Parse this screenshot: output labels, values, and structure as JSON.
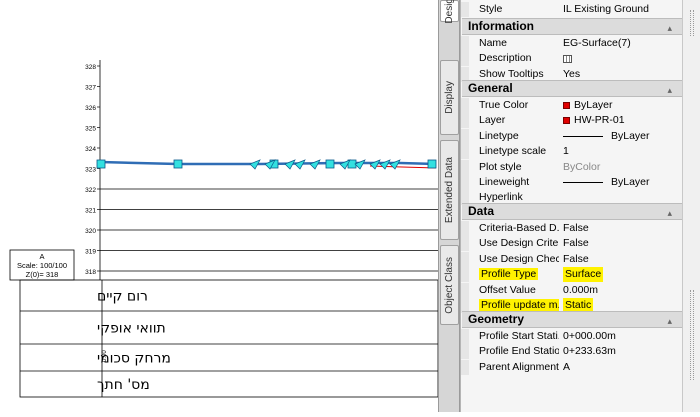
{
  "tabs": [
    {
      "label": "Desig",
      "active": true
    },
    {
      "label": "Display",
      "active": false
    },
    {
      "label": "Extended Data",
      "active": false
    },
    {
      "label": "Object Class",
      "active": false
    }
  ],
  "properties": {
    "top_row": {
      "name": "Style",
      "value": "IL Existing Ground"
    },
    "sections": [
      {
        "title": "Information",
        "rows": [
          {
            "name": "Name",
            "value": "EG-Surface(7)"
          },
          {
            "name": "Description",
            "value": "",
            "icon": "calculator-icon"
          },
          {
            "name": "Show Tooltips",
            "value": "Yes"
          }
        ]
      },
      {
        "title": "General",
        "rows": [
          {
            "name": "True Color",
            "value": "ByLayer",
            "swatch": "#e00000"
          },
          {
            "name": "Layer",
            "value": "HW-PR-01",
            "swatch": "#e00000"
          },
          {
            "name": "Linetype",
            "value": "ByLayer",
            "linetype": true
          },
          {
            "name": "Linetype scale",
            "value": "1"
          },
          {
            "name": "Plot style",
            "value": "ByColor",
            "greyed": true
          },
          {
            "name": "Lineweight",
            "value": "ByLayer",
            "linetype": true
          },
          {
            "name": "Hyperlink",
            "value": ""
          }
        ]
      },
      {
        "title": "Data",
        "rows": [
          {
            "name": "Criteria-Based D...",
            "value": "False"
          },
          {
            "name": "Use Design Crite...",
            "value": "False"
          },
          {
            "name": "Use Design Chec...",
            "value": "False"
          },
          {
            "name": "Profile Type",
            "value": "Surface",
            "highlight": true
          },
          {
            "name": "Offset Value",
            "value": "0.000m"
          },
          {
            "name": "Profile update m...",
            "value": "Static",
            "highlight": true
          }
        ]
      },
      {
        "title": "Geometry",
        "rows": [
          {
            "name": "Profile Start Stati...",
            "value": "0+000.00m"
          },
          {
            "name": "Profile End Station",
            "value": "0+233.63m"
          },
          {
            "name": "Parent Alignment",
            "value": "A"
          }
        ]
      }
    ]
  },
  "drawing": {
    "y_ticks": [
      "328",
      "327",
      "326",
      "325",
      "324",
      "323",
      "322",
      "321",
      "320",
      "319",
      "318"
    ],
    "scale_box": [
      "A",
      "Scale: 100/100",
      "Z(0)= 318"
    ],
    "table_rows": [
      "רום קיים",
      "תוואי אופקי",
      "מרחק סכומי",
      "מס' חתך"
    ],
    "distance_start": "0.00",
    "colors": {
      "profile_line": "#2f6db5",
      "marker_fill": "#33e0e0",
      "highlight": "#fff200",
      "red_line": "#e00000"
    }
  }
}
